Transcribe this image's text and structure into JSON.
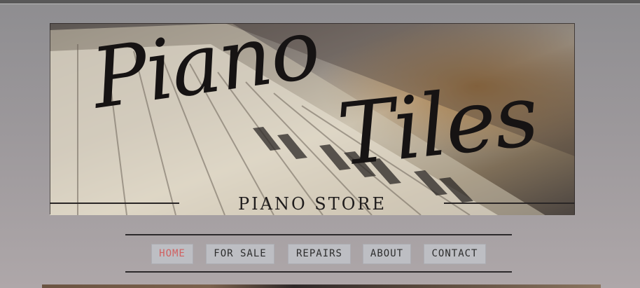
{
  "header": {
    "script_line_1": "Piano",
    "script_line_2": "Tiles",
    "store_label": "PIANO STORE"
  },
  "nav": {
    "items": [
      {
        "label": "HOME",
        "active": true
      },
      {
        "label": "FOR SALE",
        "active": false
      },
      {
        "label": "REPAIRS",
        "active": false
      },
      {
        "label": "ABOUT",
        "active": false
      },
      {
        "label": "CONTACT",
        "active": false
      }
    ]
  },
  "colors": {
    "active_nav_text": "#d06060",
    "nav_text": "#2d2d2d",
    "nav_button_bg": "#bdbec3"
  }
}
